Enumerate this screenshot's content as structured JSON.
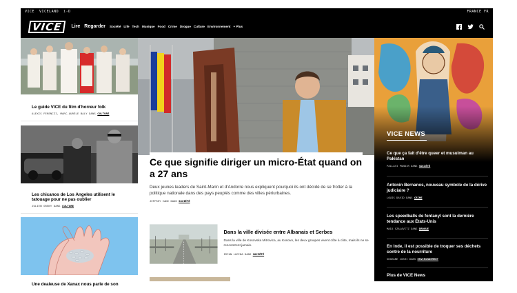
{
  "topbar": {
    "left_items": [
      "VICE",
      "VICELAND",
      "i-D"
    ],
    "region": "FRANCE FR"
  },
  "nav": {
    "logo": "VICE",
    "main_links": [
      "Lire",
      "Regarder"
    ],
    "section_links": [
      "Société",
      "Life",
      "Tech",
      "Musique",
      "Food",
      "Crime",
      "Drogue",
      "Culture",
      "Environnement",
      "+ Plus"
    ],
    "icons": [
      "facebook-icon",
      "twitter-icon",
      "search-icon"
    ]
  },
  "left_articles": [
    {
      "title": "Le guide VICE du film d'horreur folk",
      "authors": "ALEXIS FERENCZI, MARC-AURÈLE BALY",
      "dans": "DANS",
      "category": "CULTURE"
    },
    {
      "title": "Les chicanos de Los Angeles utilisent le tatouage pour ne pas oublier",
      "authors": "JULIEN GRENY",
      "dans": "DANS",
      "category": "CULTURE"
    },
    {
      "title": "Une dealeuse de Xanax nous parle de son",
      "authors": "",
      "dans": "",
      "category": ""
    }
  ],
  "hero": {
    "title": "Ce que signifie diriger un micro-État quand on a 27 ans",
    "description": "Deux jeunes leaders de Saint-Marin et d'Andorre nous expliquent pourquoi ils ont décidé de se frotter à la politique nationale dans des pays peuplés comme des villes périurbaines.",
    "author": "JEFFREY IANI",
    "dans": "DANS",
    "category": "SOCIÉTÉ"
  },
  "secondary": {
    "title": "Dans la ville divisée entre Albanais et Serbes",
    "description": "Dans la ville de Kosovska Mitrovica, au Kosovo, les deux groupes vivent côte à côte, mais ils ne se rencontrent jamais.",
    "author": "IRFAN LOCINA",
    "dans": "DANS",
    "category": "SOCIÉTÉ"
  },
  "vice_news": {
    "label": "VICE NEWS",
    "items": [
      {
        "title": "Ce que ça fait d'être queer et musulman au Pakistan",
        "author": "PALLAVI PUNDIR",
        "dans": "DANS",
        "category": "SOCIÉTÉ"
      },
      {
        "title": "Antonin Bernanos, nouveau symbole de la dérive judiciaire ?",
        "author": "LOUIS DAVID",
        "dans": "DANS",
        "category": "CRIME"
      },
      {
        "title": "Les speedballs de fentanyl sont la dernière tendance aux États-Unis",
        "author": "MAIA SZALAVITZ",
        "dans": "DANS",
        "category": "DROGUE"
      },
      {
        "title": "En Inde, il est possible de troquer ses déchets contre de la nourriture",
        "author": "SHAHANE JOSHI",
        "dans": "DANS",
        "category": "ENVIRONNEMENT"
      }
    ],
    "more": "Plus de VICE News"
  }
}
